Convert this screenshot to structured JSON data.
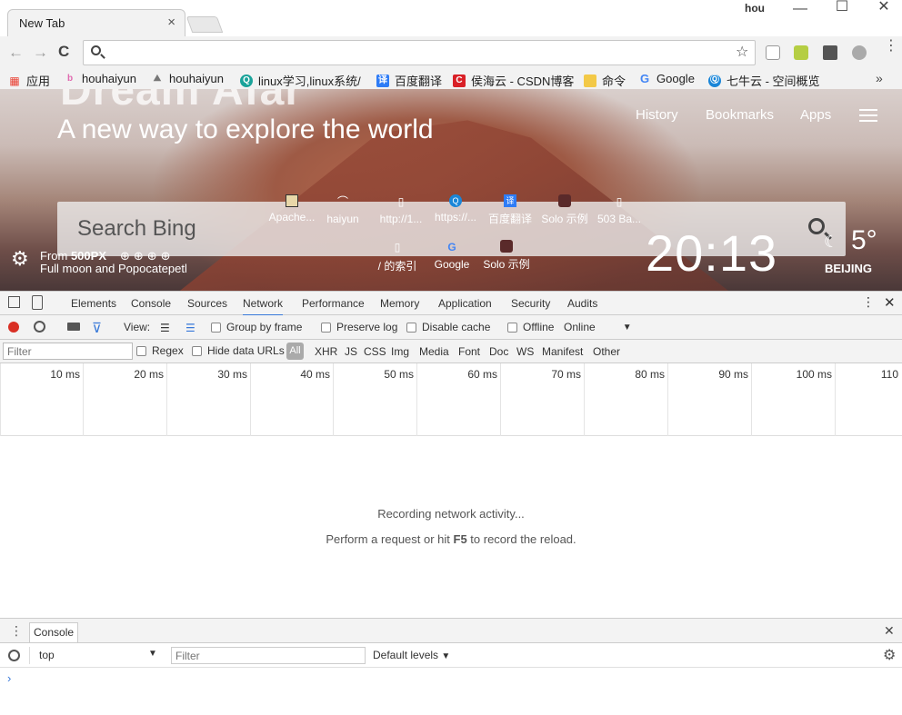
{
  "window": {
    "tab_title": "New Tab",
    "tab_close": "×",
    "profile": "hou",
    "minimize": "—",
    "maximize": "☐",
    "close": "✕"
  },
  "toolbar": {
    "back": "←",
    "forward": "→",
    "reload": "C",
    "address_value": "",
    "star": "☆",
    "menu": "⋮"
  },
  "bookmarks": [
    {
      "label": "应用",
      "color": "#e94235",
      "glyph": "▦"
    },
    {
      "label": "houhaiyun",
      "color": "#e06bb0",
      "glyph": "b"
    },
    {
      "label": "houhaiyun",
      "color": "#9a9a9a",
      "glyph": "⛰"
    },
    {
      "label": "linux学习,linux系统/",
      "color": "#1aa39a",
      "glyph": "Q"
    },
    {
      "label": "百度翻译",
      "color": "#2e7cf6",
      "glyph": "译"
    },
    {
      "label": "侯海云 - CSDN博客",
      "color": "#d92027",
      "glyph": "C"
    },
    {
      "label": "命令",
      "color": "#f3c947",
      "glyph": "▬"
    },
    {
      "label": "Google",
      "color": "#4285f4",
      "glyph": "G"
    },
    {
      "label": "七牛云 - 空间概览",
      "color": "#1a86d8",
      "glyph": "Ⓠ"
    }
  ],
  "bookmarks_more": "»",
  "hero": {
    "faded_title": "Dream Afar",
    "tagline": "A new way to explore the world",
    "nav": [
      "History",
      "Bookmarks",
      "Apps"
    ],
    "search_placeholder": "Search Bing",
    "clock": "20:13",
    "temperature": "5°",
    "city": "BEIJING",
    "photo_source_prefix": "From ",
    "photo_source_brand": "500PX",
    "photo_title": "Full moon and Popocatepetl",
    "social": "⊕⊕⊕⊕"
  },
  "shortcuts_row1": [
    "Apache...",
    "haiyun",
    "http://1...",
    "https://...",
    "百度翻译",
    "Solo 示例",
    "503 Ba..."
  ],
  "shortcuts_row2": [
    "/ 的索引",
    "Google",
    "Solo 示例"
  ],
  "devtools": {
    "tabs": [
      "Elements",
      "Console",
      "Sources",
      "Network",
      "Performance",
      "Memory",
      "Application",
      "Security",
      "Audits"
    ],
    "active_tab": "Network",
    "view_label": "View:",
    "group_by_frame": "Group by frame",
    "preserve_log": "Preserve log",
    "disable_cache": "Disable cache",
    "offline": "Offline",
    "throttling": "Online",
    "filter_placeholder": "Filter",
    "regex": "Regex",
    "hide_data_urls": "Hide data URLs",
    "all": "All",
    "types": [
      "XHR",
      "JS",
      "CSS",
      "Img",
      "Media",
      "Font",
      "Doc",
      "WS",
      "Manifest",
      "Other"
    ],
    "ticks": [
      "10 ms",
      "20 ms",
      "30 ms",
      "40 ms",
      "50 ms",
      "60 ms",
      "70 ms",
      "80 ms",
      "90 ms",
      "100 ms",
      "110"
    ],
    "recording": "Recording network activity...",
    "hint_prefix": "Perform a request or hit ",
    "hint_key": "F5",
    "hint_suffix": " to record the reload.",
    "drawer_tab": "Console",
    "context": "top",
    "console_filter_placeholder": "Filter",
    "levels": "Default levels",
    "prompt": "›"
  },
  "colors": {
    "record": "#d93025",
    "accent": "#3879d9"
  }
}
